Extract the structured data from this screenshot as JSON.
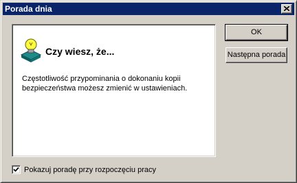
{
  "window": {
    "title": "Porada dnia"
  },
  "content": {
    "heading": "Czy wiesz, że...",
    "tip": "Częstotliwość przypominania o dokonaniu kopii bezpieczeństwa możesz zmienić w ustawieniach."
  },
  "buttons": {
    "ok": "OK",
    "next": "Następna porada"
  },
  "checkbox": {
    "label": "Pokazuj poradę przy rozpoczęciu pracy",
    "checked": true
  },
  "icons": {
    "close": "close-icon",
    "tip": "lightbulb-icon",
    "check": "checkmark-icon"
  },
  "colors": {
    "titlebar": "#0a246a",
    "face": "#d4d0c8",
    "panel": "#ffffff"
  }
}
